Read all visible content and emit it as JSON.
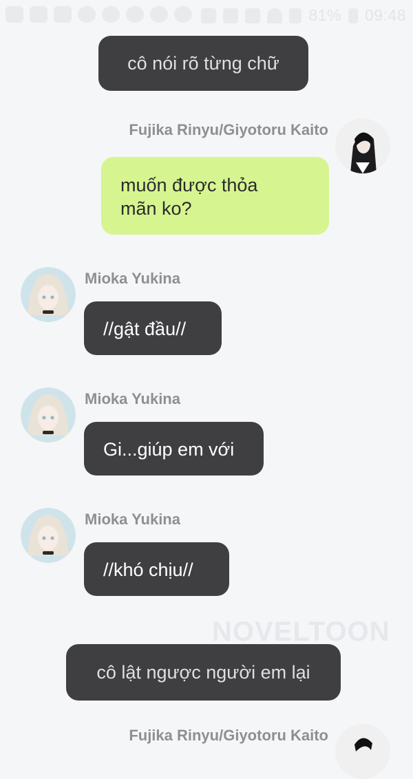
{
  "status_bar": {
    "battery": "81%",
    "time": "09:48"
  },
  "messages": [
    {
      "type": "system",
      "text": "cô nói rõ từng chữ"
    },
    {
      "type": "outgoing",
      "sender": "Fujika Rinyu/Giyotoru Kaito",
      "text": "muốn được thỏa\nmãn ko?",
      "bubble_color": "#d6f590"
    },
    {
      "type": "incoming",
      "sender": "Mioka Yukina",
      "text": "//gật đầu//"
    },
    {
      "type": "incoming",
      "sender": "Mioka Yukina",
      "text": "Gi...giúp em với"
    },
    {
      "type": "incoming",
      "sender": "Mioka Yukina",
      "text": "//khó chịu//"
    },
    {
      "type": "system",
      "text": "cô lật ngược người em lại"
    },
    {
      "type": "outgoing",
      "sender": "Fujika Rinyu/Giyotoru Kaito"
    }
  ],
  "watermark": "NOVELTOON",
  "colors": {
    "background": "#f5f6f8",
    "dark_bubble": "#3f3f41",
    "green_bubble": "#d6f590",
    "name_text": "#8e8f93"
  }
}
